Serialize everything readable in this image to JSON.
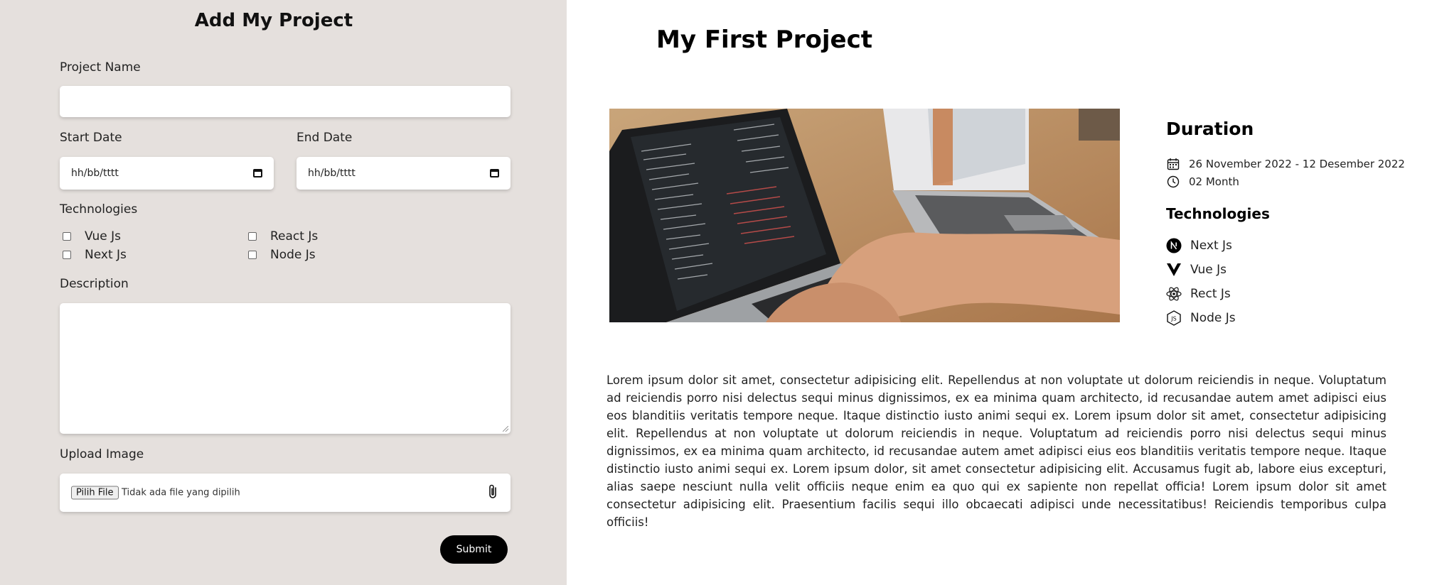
{
  "form": {
    "title": "Add My Project",
    "project_name_label": "Project Name",
    "project_name_value": "",
    "start_date_label": "Start Date",
    "start_date_placeholder": "hh/bb/tttt",
    "end_date_label": "End Date",
    "end_date_placeholder": "hh/bb/tttt",
    "technologies_label": "Technologies",
    "tech_options": [
      {
        "label": "Vue Js",
        "checked": false
      },
      {
        "label": "React Js",
        "checked": false
      },
      {
        "label": "Next Js",
        "checked": false
      },
      {
        "label": "Node Js",
        "checked": false
      }
    ],
    "description_label": "Description",
    "description_value": "",
    "upload_label": "Upload Image",
    "file_button": "Pilih File",
    "file_status": "Tidak ada file yang dipilih",
    "submit": "Submit"
  },
  "detail": {
    "title": "My First Project",
    "duration_heading": "Duration",
    "date_range": "26 November 2022 - 12 Desember 2022",
    "duration": "02 Month",
    "technologies_heading": "Technologies",
    "technologies": [
      {
        "name": "Next Js",
        "icon": "nextjs-icon"
      },
      {
        "name": "Vue Js",
        "icon": "vuejs-icon"
      },
      {
        "name": "Rect Js",
        "icon": "react-icon"
      },
      {
        "name": "Node Js",
        "icon": "nodejs-icon"
      }
    ],
    "description": "Lorem ipsum dolor sit amet, consectetur adipisicing elit. Repellendus at non voluptate ut dolorum reiciendis in neque. Voluptatum ad reiciendis porro nisi delectus sequi minus dignissimos, ex ea minima quam architecto, id recusandae autem amet adipisci eius eos blanditiis veritatis tempore neque. Itaque distinctio iusto animi sequi ex. Lorem ipsum dolor sit amet, consectetur adipisicing elit. Repellendus at non voluptate ut dolorum reiciendis in neque. Voluptatum ad reiciendis porro nisi delectus sequi minus dignissimos, ex ea minima quam architecto, id recusandae autem amet adipisci eius eos blanditiis veritatis tempore neque. Itaque distinctio iusto animi sequi ex. Lorem ipsum dolor, sit amet consectetur adipisicing elit. Accusamus fugit ab, labore eius excepturi, alias saepe nesciunt nulla velit officiis neque enim ea quo qui ex sapiente non repellat officia! Lorem ipsum dolor sit amet consectetur adipisicing elit. Praesentium facilis sequi illo obcaecati adipisci unde necessitatibus! Reiciendis temporibus culpa officiis!"
  },
  "colors": {
    "left_panel_bg": "#e5e0dd",
    "accent": "#000000"
  }
}
